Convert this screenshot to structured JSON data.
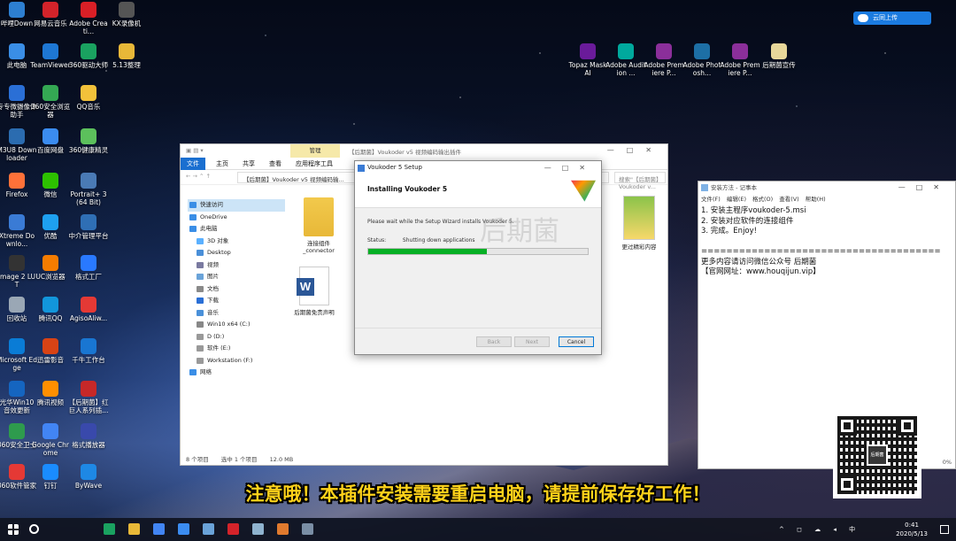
{
  "desktop": {
    "left_icons": [
      {
        "label": "哔哩Down",
        "color": "#2d7fd1"
      },
      {
        "label": "网易云音乐",
        "color": "#d4232a"
      },
      {
        "label": "Adobe Creati...",
        "color": "#da1f26"
      },
      {
        "label": "KX录像机",
        "color": "#555"
      },
      {
        "label": "此电脑",
        "color": "#3a8ee6"
      },
      {
        "label": "TeamViewer",
        "color": "#1e77d3"
      },
      {
        "label": "360驱动大师",
        "color": "#1aa260"
      },
      {
        "label": "5.13整理",
        "color": "#e8b838"
      },
      {
        "label": "专专微摄像体助手",
        "color": "#2a6fd6"
      },
      {
        "label": "360安全浏览器",
        "color": "#34a853"
      },
      {
        "label": "QQ音乐",
        "color": "#f2c13a"
      },
      {
        "label": "M3U8 Downloader",
        "color": "#2b6cb0"
      },
      {
        "label": "百度网盘",
        "color": "#3b8cf0"
      },
      {
        "label": "360健康精灵",
        "color": "#5cc05c"
      },
      {
        "label": "Firefox",
        "color": "#ff7139"
      },
      {
        "label": "微信",
        "color": "#2dc100"
      },
      {
        "label": "Portrait+ 3(64 Bit)",
        "color": "#4a7ab5"
      },
      {
        "label": "Xtreme Downlo...",
        "color": "#3a7bd5"
      },
      {
        "label": "优酷",
        "color": "#1ea0f0"
      },
      {
        "label": "中介管理平台",
        "color": "#2f6fb5"
      },
      {
        "label": "Image 2 LUT",
        "color": "#333"
      },
      {
        "label": "UC浏览器",
        "color": "#f57c00"
      },
      {
        "label": "格式工厂",
        "color": "#2979ff"
      },
      {
        "label": "回收站",
        "color": "#9aa7b5"
      },
      {
        "label": "腾讯QQ",
        "color": "#1296db"
      },
      {
        "label": "AgisoAliw...",
        "color": "#e53935"
      },
      {
        "label": "Microsoft Edge",
        "color": "#0a7cd6"
      },
      {
        "label": "迅雷影音",
        "color": "#d84315"
      },
      {
        "label": "千牛工作台",
        "color": "#1976d2"
      },
      {
        "label": "光华Win10音效更新",
        "color": "#1565c0"
      },
      {
        "label": "腾讯视频",
        "color": "#ff8f00"
      },
      {
        "label": "【后期菌】红巨人系列插...",
        "color": "#c62828"
      },
      {
        "label": "360安全卫士",
        "color": "#2e9b4d"
      },
      {
        "label": "Google Chrome",
        "color": "#4285f4"
      },
      {
        "label": "格式播放器",
        "color": "#3949ab"
      },
      {
        "label": "360软件管家",
        "color": "#e53935"
      },
      {
        "label": "钉钉",
        "color": "#1a8cff"
      },
      {
        "label": "ByWave",
        "color": "#1e88e5"
      }
    ],
    "top_icons": [
      {
        "label": "Topaz Mask AI",
        "color": "#6a1b9a"
      },
      {
        "label": "Adobe Audition ...",
        "color": "#00a99d"
      },
      {
        "label": "Adobe Premiere P...",
        "color": "#8b2f9a"
      },
      {
        "label": "Adobe Photosh...",
        "color": "#1d6fa5"
      },
      {
        "label": "Adobe Premiere P...",
        "color": "#8b2f9a"
      },
      {
        "label": "后期菌宣传",
        "color": "#e8d89a"
      }
    ],
    "cloud_button": "云同上传"
  },
  "explorer": {
    "manage_tab": "管理",
    "title": "【后期菌】Voukoder v5 视频编码输出插件",
    "ribbon": {
      "file": "文件",
      "home": "主页",
      "share": "共享",
      "view": "查看",
      "app_tools": "应用程序工具"
    },
    "address": "【后期菌】Voukoder v5 视频编码输...",
    "search": "搜索\"【后期菌】Voukoder v...",
    "nav": [
      "快速访问",
      "OneDrive",
      "此电脑",
      "3D 对象",
      "Desktop",
      "视频",
      "图片",
      "文档",
      "下载",
      "音乐",
      "Win10 x64 (C:)",
      "D (D:)",
      "软件 (E:)",
      "Workstation (F:)",
      "网络"
    ],
    "files": {
      "connector": "连接组件_connector",
      "disclaimer": "后期菌免责声明",
      "promo": "更过精彩内容"
    },
    "status": {
      "count": "8 个项目",
      "selected": "选中 1 个项目",
      "size": "12.0 MB"
    }
  },
  "setup": {
    "title": "Voukoder 5 Setup",
    "heading": "Installing Voukoder 5",
    "message": "Please wait while the Setup Wizard installs Voukoder 5.",
    "status_label": "Status:",
    "status_value": "Shutting down applications",
    "progress": 0.54,
    "back": "Back",
    "next": "Next",
    "cancel": "Cancel"
  },
  "watermark": "后期菌",
  "notepad": {
    "title": "安装方法 - 记事本",
    "menu": [
      "文件(F)",
      "编辑(E)",
      "格式(O)",
      "查看(V)",
      "帮助(H)"
    ],
    "text": "1. 安装主程序voukoder-5.msi\n2. 安装对应软件的连接组件\n3. 完成。Enjoy!\n\n======================================\n更多内容请访问微信公众号 后期菌\n【官网网址：www.houqijun.vip】",
    "zoom": "0%"
  },
  "qr_center": "后期菌",
  "subtitle": "注意哦！本插件安装需要重启电脑，请提前保存好工作！",
  "taskbar": {
    "apps": [
      {
        "name": "360",
        "color": "#1aa260"
      },
      {
        "name": "folder",
        "color": "#e8b838"
      },
      {
        "name": "chrome",
        "color": "#4285f4"
      },
      {
        "name": "baidu",
        "color": "#3b8cf0"
      },
      {
        "name": "app",
        "color": "#6aa3d9"
      },
      {
        "name": "ae",
        "color": "#d4232a"
      },
      {
        "name": "note",
        "color": "#8fb3cf"
      },
      {
        "name": "game",
        "color": "#e07a2e"
      },
      {
        "name": "setup",
        "color": "#7a8ea5"
      }
    ],
    "tray": "^ ◻ ☁ ◂ 中",
    "time": "0:41",
    "date": "2020/5/13"
  }
}
